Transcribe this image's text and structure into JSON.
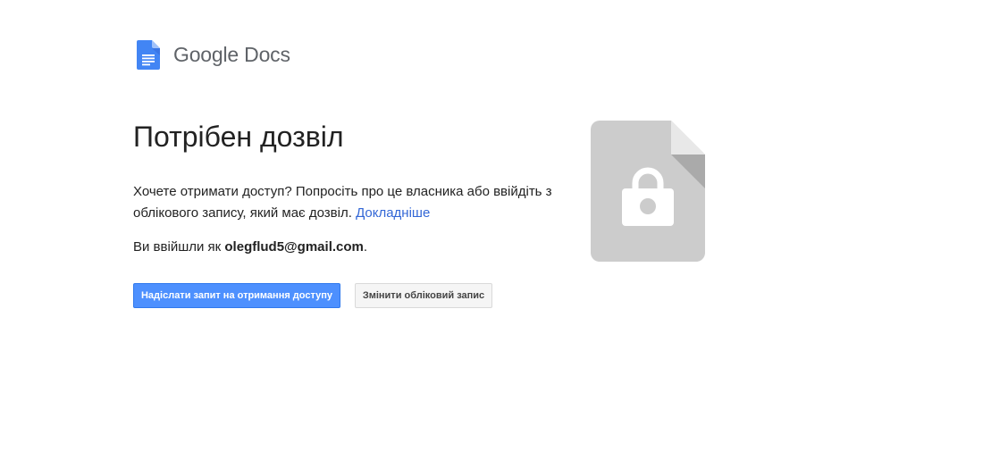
{
  "header": {
    "brand": "Google",
    "product": "Docs"
  },
  "main": {
    "title": "Потрібен дозвіл",
    "description": "Хочете отримати доступ? Попросіть про це власника або ввійдіть з облікового запису, який має дозвіл.",
    "learn_more": "Докладніше",
    "signed_in_prefix": "Ви ввійшли як",
    "email": "olegflud5@gmail.com",
    "signed_in_suffix": "."
  },
  "actions": {
    "request_access": "Надіслати запит на отримання доступу",
    "switch_account": "Змінити обліковий запис"
  },
  "icons": {
    "logo": "google-docs-icon",
    "illustration": "locked-file-icon"
  },
  "colors": {
    "accent": "#4d90fe",
    "link": "#3367d6",
    "docs_blue": "#4285f4",
    "file_gray": "#cfcfcf"
  }
}
